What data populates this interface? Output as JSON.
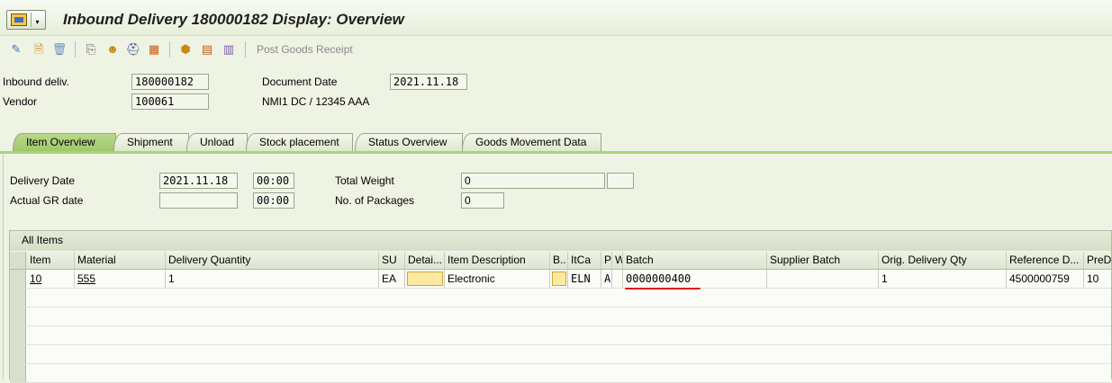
{
  "window": {
    "title": "Inbound Delivery 180000182 Display: Overview"
  },
  "toolbar": {
    "icons": [
      "edit-icon",
      "create-icon",
      "delete-icon",
      "transfer-icon",
      "partner-icon",
      "hat-icon",
      "transport-icon",
      "package-icon",
      "picking-icon",
      "grid-icon"
    ],
    "post_goods_receipt": "Post Goods Receipt"
  },
  "header": {
    "inbound_deliv_label": "Inbound deliv.",
    "inbound_deliv_value": "180000182",
    "vendor_label": "Vendor",
    "vendor_value": "100061",
    "vendor_desc": "NMI1 DC / 12345 AAA",
    "doc_date_label": "Document Date",
    "doc_date_value": "2021.11.18"
  },
  "tabs": [
    {
      "label": "Item Overview",
      "active": true
    },
    {
      "label": "Shipment"
    },
    {
      "label": "Unload"
    },
    {
      "label": "Stock placement"
    },
    {
      "label": "Status Overview"
    },
    {
      "label": "Goods Movement Data"
    }
  ],
  "item_overview": {
    "delivery_date_label": "Delivery Date",
    "delivery_date_value": "2021.11.18",
    "delivery_time_value": "00:00",
    "actual_gr_label": "Actual GR date",
    "actual_gr_value": "",
    "actual_gr_time": "00:00",
    "total_weight_label": "Total Weight",
    "total_weight_value": "0",
    "total_weight_unit": "",
    "packages_label": "No. of Packages",
    "packages_value": "0"
  },
  "items_table": {
    "caption": "All Items",
    "columns": [
      "Item",
      "Material",
      "Delivery Quantity",
      "SU",
      "Detai...",
      "Item Description",
      "B..",
      "ItCa",
      "P",
      "W",
      "Batch",
      "Supplier Batch",
      "Orig. Delivery Qty",
      "Reference D...",
      "PreDc"
    ],
    "rows": [
      {
        "item": "10",
        "material": "555",
        "delivery_quantity": "1",
        "su": "EA",
        "item_description": "Electronic",
        "itca": "ELN",
        "p": "A",
        "batch": "0000000400",
        "orig_delivery_qty": "1",
        "reference_doc": "4500000759",
        "predc": "10"
      }
    ]
  }
}
